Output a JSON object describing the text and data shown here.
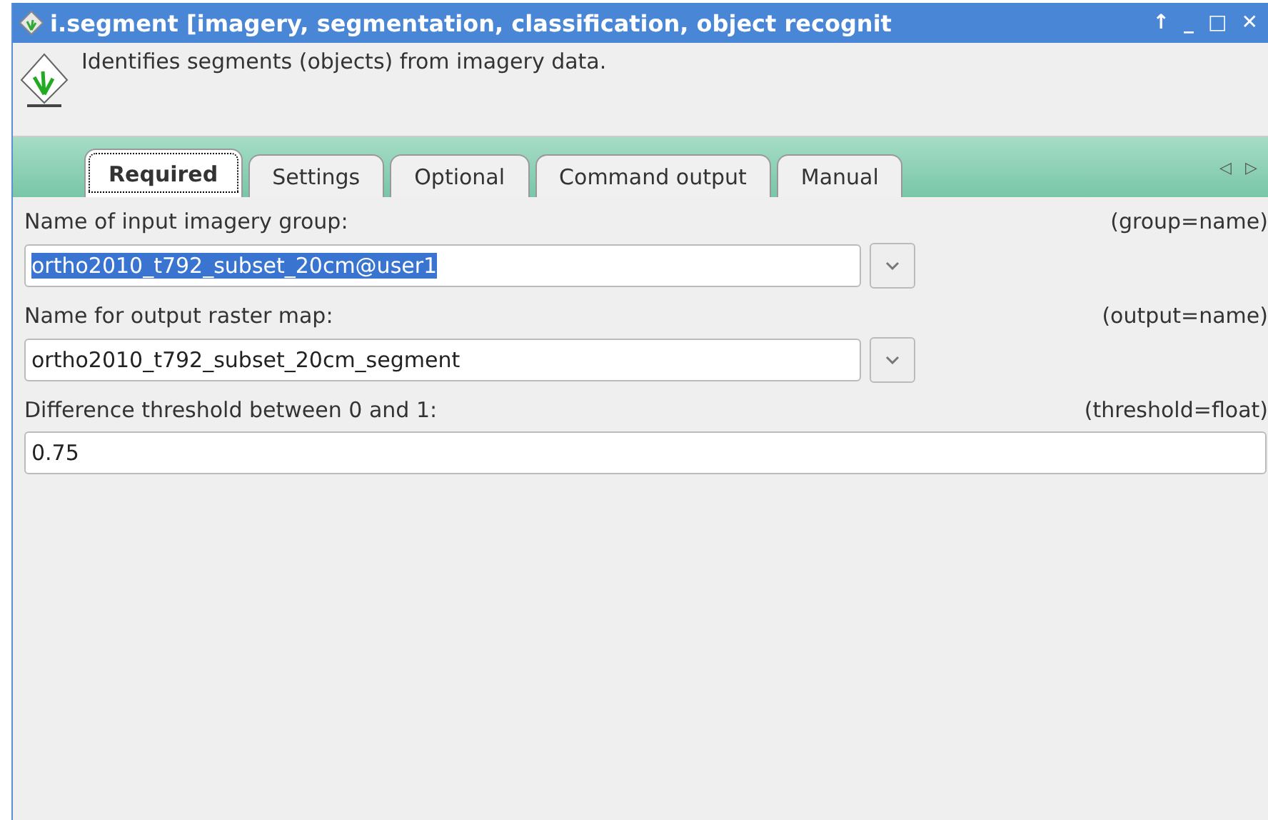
{
  "window": {
    "title": "i.segment [imagery, segmentation, classification, object recognit",
    "buttons": [
      "↑",
      "_",
      "□",
      "✕"
    ]
  },
  "description": "Identifies segments (objects) from imagery data.",
  "tabs": [
    {
      "label": "Required",
      "selected": true
    },
    {
      "label": "Settings",
      "selected": false
    },
    {
      "label": "Optional",
      "selected": false
    },
    {
      "label": "Command output",
      "selected": false
    },
    {
      "label": "Manual",
      "selected": false
    }
  ],
  "tab_scroll": [
    "◁",
    "▷"
  ],
  "fields": [
    {
      "kind": "combo",
      "label": "Name of input imagery group:",
      "param": "(group=name)",
      "value": "ortho2010_t792_subset_20cm@user1",
      "text_selected": true
    },
    {
      "kind": "combo",
      "label": "Name for output raster map:",
      "param": "(output=name)",
      "value": "ortho2010_t792_subset_20cm_segment",
      "text_selected": false
    },
    {
      "kind": "text",
      "label": "Difference threshold between 0 and 1:",
      "param": "(threshold=float)",
      "value": "0.75",
      "text_selected": false
    }
  ]
}
